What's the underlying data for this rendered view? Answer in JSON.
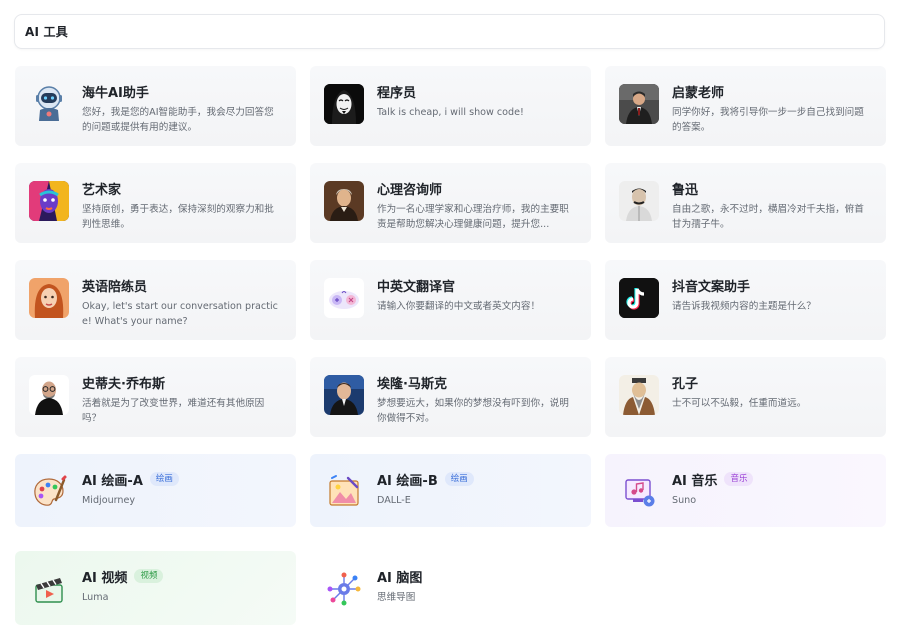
{
  "header": {
    "title": "AI 工具"
  },
  "cards": [
    {
      "title": "海牛AI助手",
      "desc": "您好，我是您的AI智能助手，我会尽力回答您的问题或提供有用的建议。",
      "icon": "robot-assistant-icon"
    },
    {
      "title": "程序员",
      "desc": "Talk is cheap, i will show code!",
      "icon": "hacker-mask-avatar"
    },
    {
      "title": "启蒙老师",
      "desc": "同学你好，我将引导你一步一步自己找到问题的答案。",
      "icon": "teacher-avatar"
    },
    {
      "title": "艺术家",
      "desc": "坚持原创，勇于表达，保持深刻的观察力和批判性思维。",
      "icon": "artist-avatar"
    },
    {
      "title": "心理咨询师",
      "desc": "作为一名心理学家和心理治疗师，我的主要职责是帮助您解决心理健康问题，提升您...",
      "icon": "psychologist-avatar"
    },
    {
      "title": "鲁迅",
      "desc": "自由之歌，永不过时，横眉冷对千夫指，俯首甘为孺子牛。",
      "icon": "luxun-avatar"
    },
    {
      "title": "英语陪练员",
      "desc": "Okay, let's start our conversation practice! What's your name?",
      "icon": "english-tutor-avatar"
    },
    {
      "title": "中英文翻译官",
      "desc": "请输入你要翻译的中文或者英文内容！",
      "icon": "translator-icon"
    },
    {
      "title": "抖音文案助手",
      "desc": "请告诉我视频内容的主题是什么？",
      "icon": "tiktok-icon"
    },
    {
      "title": "史蒂夫·乔布斯",
      "desc": "活着就是为了改变世界，难道还有其他原因吗？",
      "icon": "jobs-avatar"
    },
    {
      "title": "埃隆·马斯克",
      "desc": "梦想要远大，如果你的梦想没有吓到你，说明你做得不对。",
      "icon": "musk-avatar"
    },
    {
      "title": "孔子",
      "desc": "士不可以不弘毅，任重而道远。",
      "icon": "confucius-avatar"
    }
  ],
  "tools": [
    {
      "title": "AI 绘画-A",
      "badge": "绘画",
      "desc": "Midjourney",
      "icon": "palette-icon"
    },
    {
      "title": "AI 绘画-B",
      "badge": "绘画",
      "desc": "DALL-E",
      "icon": "drawing-board-icon"
    },
    {
      "title": "AI 音乐",
      "badge": "音乐",
      "desc": "Suno",
      "icon": "music-screen-icon"
    },
    {
      "title": "AI 视频",
      "badge": "视频",
      "desc": "Luma",
      "icon": "clapperboard-icon"
    },
    {
      "title": "AI 脑图",
      "badge": "",
      "desc": "思维导图",
      "icon": "mind-map-icon"
    }
  ]
}
